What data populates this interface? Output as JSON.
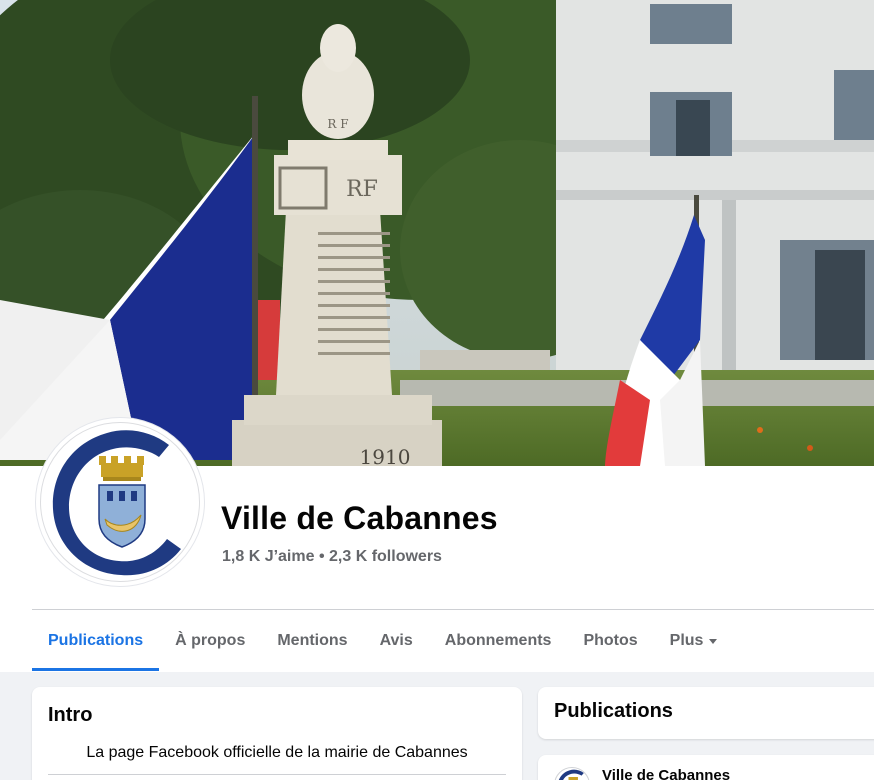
{
  "page": {
    "name": "Ville de Cabannes",
    "likes": "1,8 K J’aime",
    "separator": "•",
    "followers": "2,3 K followers"
  },
  "cover": {
    "monument_text": "R F",
    "monument_year": "1910"
  },
  "tabs": [
    {
      "label": "Publications",
      "active": true
    },
    {
      "label": "À propos"
    },
    {
      "label": "Mentions"
    },
    {
      "label": "Avis"
    },
    {
      "label": "Abonnements"
    },
    {
      "label": "Photos"
    },
    {
      "label": "Plus"
    }
  ],
  "intro": {
    "title": "Intro",
    "text": "La page Facebook officielle de la mairie de Cabannes"
  },
  "publications": {
    "title": "Publications",
    "post_author": "Ville de Cabannes"
  },
  "colors": {
    "accent": "#1b74e4",
    "logo_blue": "#1f3a82",
    "crown_gold": "#c9a227"
  }
}
